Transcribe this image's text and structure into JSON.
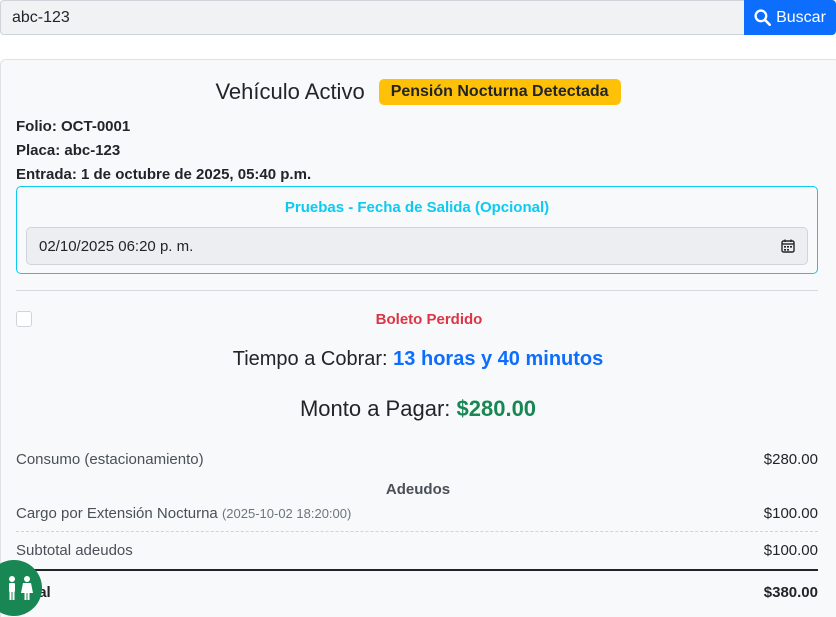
{
  "search": {
    "value": "abc-123",
    "button_label": "Buscar"
  },
  "header": {
    "title": "Vehículo Activo",
    "badge": "Pensión Nocturna Detectada"
  },
  "info": {
    "folio": "Folio: OCT-0001",
    "placa": "Placa: abc-123",
    "entrada": "Entrada: 1 de octubre de 2025, 05:40 p.m."
  },
  "test_exit": {
    "label": "Pruebas - Fecha de Salida (Opcional)",
    "value": "02/10/2025 06:20  p. m."
  },
  "lost_ticket": {
    "label": "Boleto Perdido",
    "checked": false
  },
  "charge": {
    "time_label": "Tiempo a Cobrar:",
    "time_value": "13 horas y 40 minutos",
    "amount_label": "Monto a Pagar:",
    "amount_value": "$280.00"
  },
  "breakdown": {
    "consumo_label": "Consumo (estacionamiento)",
    "consumo_amount": "$280.00",
    "adeudos_title": "Adeudos",
    "extension_label": "Cargo por Extensión Nocturna",
    "extension_date": "(2025-10-02 18:20:00)",
    "extension_amount": "$100.00",
    "subtotal_label": "Subtotal adeudos",
    "subtotal_amount": "$100.00",
    "total_label": "Total",
    "total_amount": "$380.00"
  },
  "icons": {
    "search": "search-icon",
    "calendar": "calendar-icon",
    "restroom": "restroom-icon"
  },
  "colors": {
    "primary": "#0d6efd",
    "warning": "#ffc107",
    "info": "#0dcaf0",
    "danger": "#dc3545",
    "success": "#198754"
  }
}
